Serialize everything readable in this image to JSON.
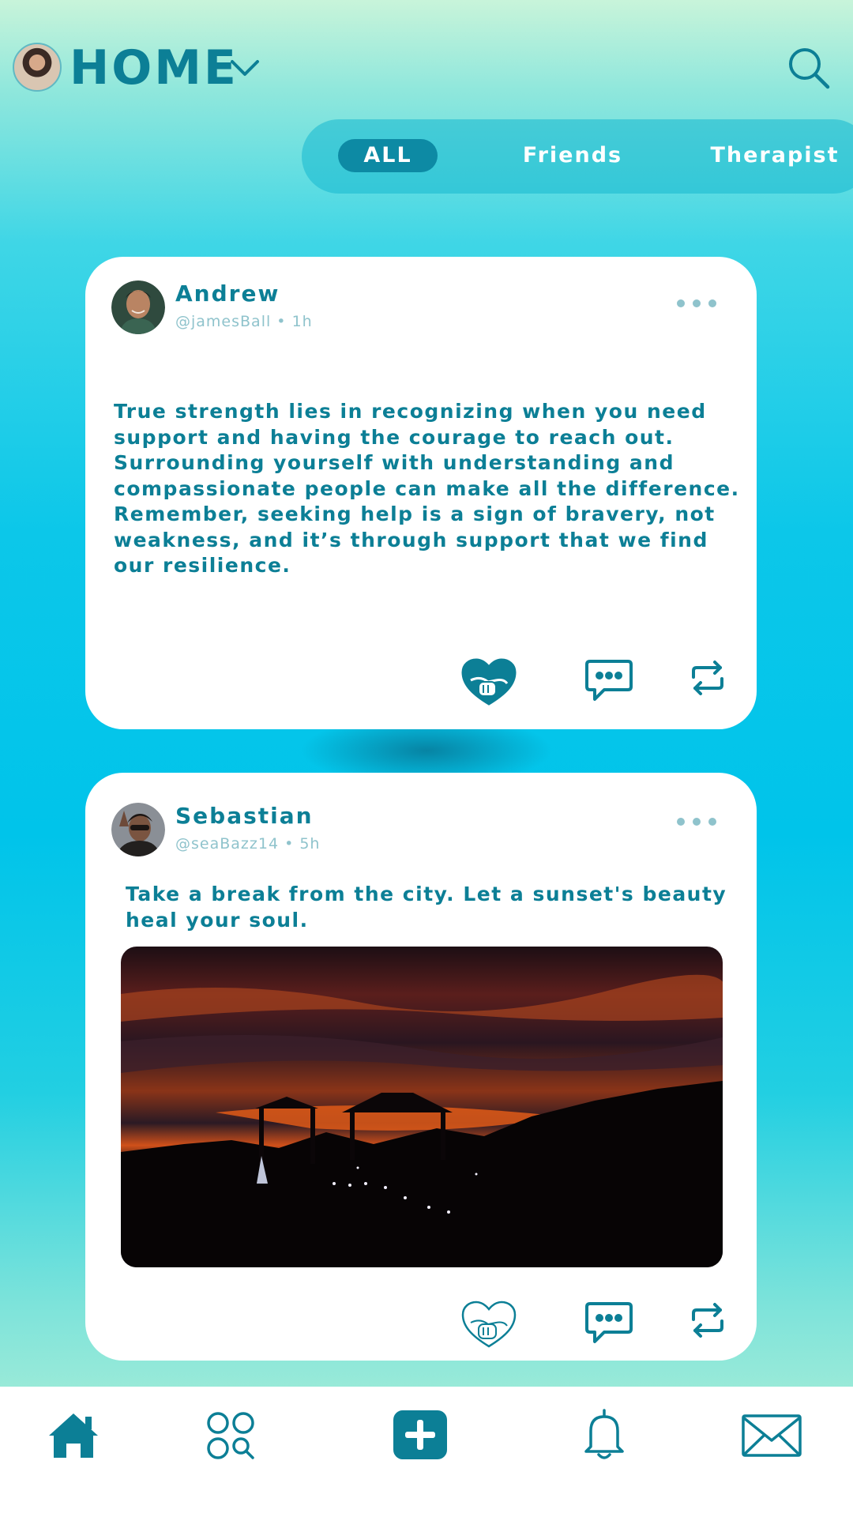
{
  "header": {
    "title": "HOME",
    "avatar_icon": "profile-avatar",
    "dropdown_icon": "chevron-down-icon",
    "search_icon": "search-icon"
  },
  "tabs": [
    {
      "label": "ALL",
      "active": true
    },
    {
      "label": "Friends",
      "active": false
    },
    {
      "label": "Therapist",
      "active": false
    }
  ],
  "posts": [
    {
      "name": "Andrew",
      "handle": "@jamesBall",
      "time": "1h",
      "text_lines": [
        "True strength lies in recognizing when you need",
        "support and having the courage to reach out.",
        "Surrounding yourself with understanding and",
        "compassionate people can make all the difference.",
        "Remember, seeking help is a sign of bravery, not",
        "weakness, and it’s through support that we find",
        "our resilience."
      ],
      "hug_active": true
    },
    {
      "name": "Sebastian",
      "handle": "@seaBazz14",
      "time": "5h",
      "text_lines": [
        "Take a break from the city. Let a sunset's beauty",
        "heal your soul."
      ],
      "has_image": true,
      "hug_active": false
    }
  ],
  "actions": [
    "hug-heart-icon",
    "comment-icon",
    "repost-icon"
  ],
  "bottom_nav": [
    "home-icon",
    "explore-icon",
    "create-post-icon",
    "notifications-icon",
    "messages-icon"
  ],
  "colors": {
    "primary": "#0c7f96",
    "tab_active": "#0d8aa4",
    "muted": "#8fc3cc"
  }
}
